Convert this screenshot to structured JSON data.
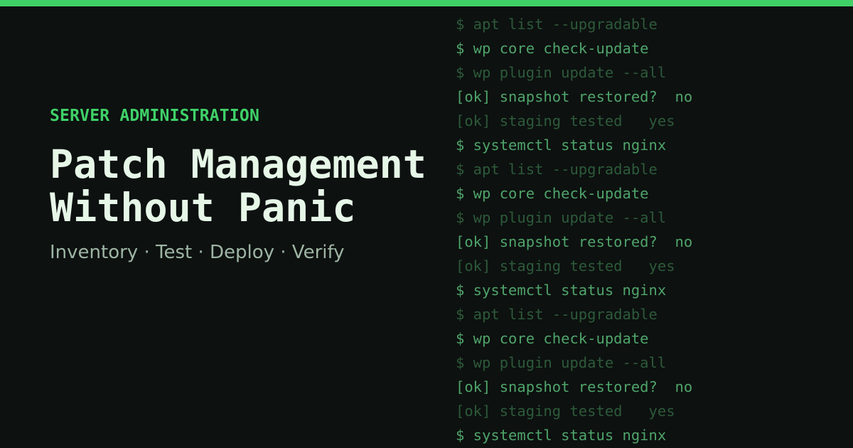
{
  "colors": {
    "background": "#0d1110",
    "accent": "#3fd168",
    "title": "#e6f7e8",
    "subtitle": "#9eb5a4",
    "terminal_bright": "#4fa46a",
    "terminal_dim": "#2d5a3a"
  },
  "eyebrow": "SERVER ADMINISTRATION",
  "title_lines": [
    "Patch Management",
    "Without Panic"
  ],
  "subtitle": "Inventory · Test · Deploy · Verify",
  "terminal_lines": [
    {
      "text": "$ apt list --upgradable",
      "tone": "dim"
    },
    {
      "text": "$ wp core check-update",
      "tone": "bright"
    },
    {
      "text": "$ wp plugin update --all",
      "tone": "dim"
    },
    {
      "text": "[ok] snapshot restored?  no",
      "tone": "bright"
    },
    {
      "text": "[ok] staging tested   yes",
      "tone": "dim"
    },
    {
      "text": "$ systemctl status nginx",
      "tone": "bright"
    },
    {
      "text": "$ apt list --upgradable",
      "tone": "dim"
    },
    {
      "text": "$ wp core check-update",
      "tone": "bright"
    },
    {
      "text": "$ wp plugin update --all",
      "tone": "dim"
    },
    {
      "text": "[ok] snapshot restored?  no",
      "tone": "bright"
    },
    {
      "text": "[ok] staging tested   yes",
      "tone": "dim"
    },
    {
      "text": "$ systemctl status nginx",
      "tone": "bright"
    },
    {
      "text": "$ apt list --upgradable",
      "tone": "dim"
    },
    {
      "text": "$ wp core check-update",
      "tone": "bright"
    },
    {
      "text": "$ wp plugin update --all",
      "tone": "dim"
    },
    {
      "text": "[ok] snapshot restored?  no",
      "tone": "bright"
    },
    {
      "text": "[ok] staging tested   yes",
      "tone": "dim"
    },
    {
      "text": "$ systemctl status nginx",
      "tone": "bright"
    }
  ]
}
